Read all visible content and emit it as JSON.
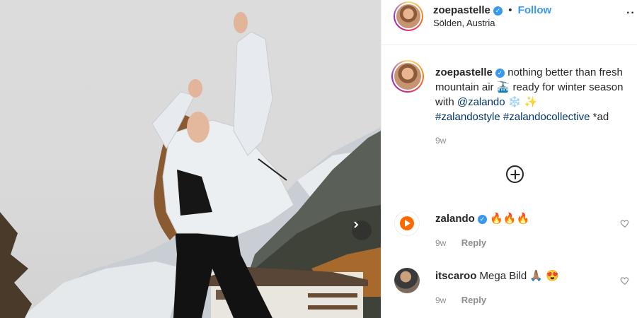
{
  "post": {
    "username": "zoepastelle",
    "location": "Sölden, Austria",
    "follow_label": "Follow",
    "header_separator": "•",
    "more_label": "··",
    "caption_text_1": "nothing better than fresh mountain air 🚠 ready for winter season with ",
    "caption_mention": "@zalando",
    "caption_emoji": " ❄️ ✨",
    "caption_tag_1": "#zalandostyle",
    "caption_tag_2": "#zalandocollective",
    "caption_suffix": " *ad",
    "caption_time": "9w"
  },
  "comments": [
    {
      "username": "zalando",
      "text": "🔥🔥🔥",
      "time": "9w",
      "reply_label": "Reply",
      "verified": true
    },
    {
      "username": "itscaroo",
      "text": "Mega Bild 🙏🏽 😍",
      "time": "9w",
      "reply_label": "Reply",
      "verified": false
    }
  ],
  "colors": {
    "link": "#3897f0",
    "hashtag": "#003569",
    "zalando_orange": "#ff6900"
  },
  "icons": {
    "verified": "verified-badge-icon",
    "load_more": "plus-circle-icon",
    "next": "chevron-right-icon",
    "like": "heart-outline-icon"
  }
}
